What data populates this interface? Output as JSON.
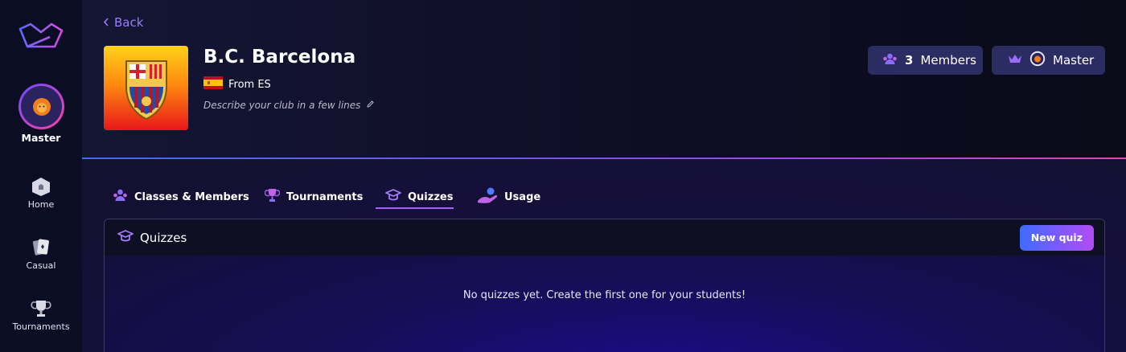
{
  "sidebar": {
    "user_label": "Master",
    "items": [
      {
        "label": "Home",
        "icon": "home-icon"
      },
      {
        "label": "Casual",
        "icon": "cards-icon"
      },
      {
        "label": "Tournaments",
        "icon": "trophy-icon"
      }
    ]
  },
  "header": {
    "back_label": "Back",
    "club_name": "B.C. Barcelona",
    "from_label": "From ES",
    "description_placeholder": "Describe your club in a few lines",
    "members_count": "3",
    "members_label": "Members",
    "master_label": "Master"
  },
  "tabs": [
    {
      "label": "Classes & Members",
      "icon": "members-icon"
    },
    {
      "label": "Tournaments",
      "icon": "trophy-icon"
    },
    {
      "label": "Quizzes",
      "icon": "graduation-cap-icon",
      "active": true
    },
    {
      "label": "Usage",
      "icon": "usage-icon"
    }
  ],
  "quizzes_panel": {
    "title": "Quizzes",
    "new_button": "New quiz",
    "empty_message": "No quizzes yet. Create the first one for your students!"
  },
  "colors": {
    "accent": "#9b7cff",
    "pill_bg": "#2b2d62",
    "button_gradient_start": "#3f6bff",
    "button_gradient_end": "#b24cf4"
  }
}
